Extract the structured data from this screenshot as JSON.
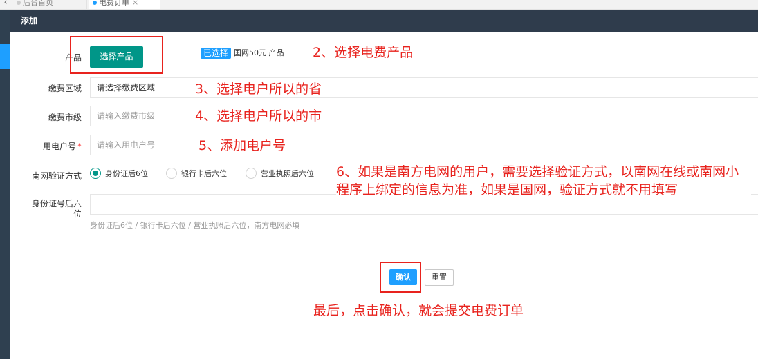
{
  "tabs": [
    {
      "label": "后台首页",
      "active": false
    },
    {
      "label": "电费订单",
      "active": true
    }
  ],
  "header": {
    "title": "添加"
  },
  "form": {
    "product": {
      "label": "产品",
      "button": "选择产品",
      "selected_badge": "已选择",
      "selected_text": "国网50元 产品"
    },
    "region": {
      "label": "缴费区域",
      "value": "请选择缴费区域"
    },
    "city": {
      "label": "缴费市级",
      "placeholder": "请输入缴费市级"
    },
    "account": {
      "label": "用电户号",
      "required_mark": "*",
      "placeholder": "请输入用电户号"
    },
    "verify": {
      "label": "南网验证方式",
      "options": [
        "身份证后6位",
        "银行卡后六位",
        "营业执照后六位"
      ],
      "selected": "身份证后6位"
    },
    "id_suffix": {
      "label_line1": "身份证号后六",
      "label_line2": "位",
      "value": "",
      "hint": "身份证后6位 / 银行卡后六位 / 营业执照后六位，南方电网必填"
    }
  },
  "actions": {
    "confirm": "确认",
    "reset": "重置"
  },
  "annotations": {
    "step2": "2、选择电费产品",
    "step3": "3、选择电户所以的省",
    "step4": "4、选择电户所以的市",
    "step5": "5、添加电户号",
    "step6": "6、如果是南方电网的用户，需要选择验证方式，以南网在线或南网小程序上绑定的信息为准，如果是国网，验证方式就不用填写",
    "final": "最后，点击确认，就会提交电费订单"
  },
  "colors": {
    "header": "#2f3c4c",
    "primary": "#009688",
    "confirm": "#1e9fff",
    "annotation": "#e8231e"
  }
}
